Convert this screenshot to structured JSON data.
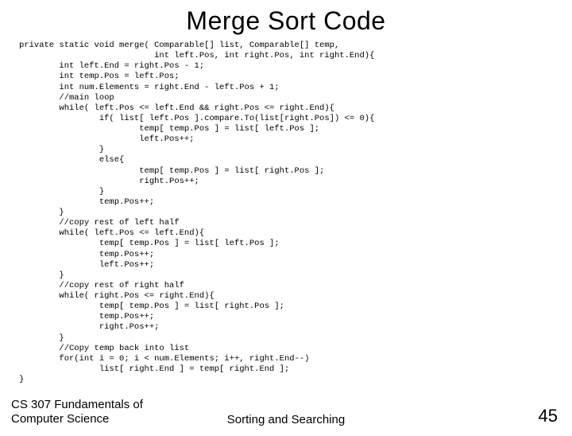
{
  "title": "Merge Sort Code",
  "code": "private static void merge( Comparable[] list, Comparable[] temp,\n                           int left.Pos, int right.Pos, int right.End){\n        int left.End = right.Pos - 1;\n        int temp.Pos = left.Pos;\n        int num.Elements = right.End - left.Pos + 1;\n        //main loop\n        while( left.Pos <= left.End && right.Pos <= right.End){\n                if( list[ left.Pos ].compare.To(list[right.Pos]) <= 0){\n                        temp[ temp.Pos ] = list[ left.Pos ];\n                        left.Pos++;\n                }\n                else{\n                        temp[ temp.Pos ] = list[ right.Pos ];\n                        right.Pos++;\n                }\n                temp.Pos++;\n        }\n        //copy rest of left half\n        while( left.Pos <= left.End){\n                temp[ temp.Pos ] = list[ left.Pos ];\n                temp.Pos++;\n                left.Pos++;\n        }\n        //copy rest of right half\n        while( right.Pos <= right.End){\n                temp[ temp.Pos ] = list[ right.Pos ];\n                temp.Pos++;\n                right.Pos++;\n        }\n        //Copy temp back into list\n        for(int i = 0; i < num.Elements; i++, right.End--)\n                list[ right.End ] = temp[ right.End ];\n}",
  "footer": {
    "left": "CS 307 Fundamentals of Computer Science",
    "center": "Sorting and Searching",
    "right": "45"
  }
}
